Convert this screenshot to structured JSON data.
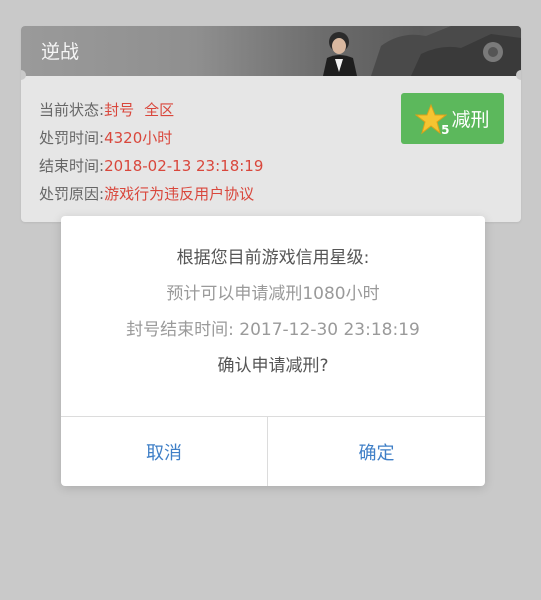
{
  "card": {
    "title": "逆战",
    "status_label": "当前状态:",
    "status_value_1": "封号",
    "status_value_2": "全区",
    "time_label": "处罚时间:",
    "time_value": "4320小时",
    "end_label": "结束时间:",
    "end_value": "2018-02-13 23:18:19",
    "reason_label": "处罚原因:",
    "reason_value": "游戏行为违反用户协议",
    "reduce_button": {
      "label": "减刑",
      "star_count": "5",
      "icon": "star-icon"
    }
  },
  "dialog": {
    "line1": "根据您目前游戏信用星级:",
    "line2": "预计可以申请减刑1080小时",
    "line3": "封号结束时间: 2017-12-30 23:18:19",
    "line4": "确认申请减刑?",
    "cancel_label": "取消",
    "confirm_label": "确定"
  },
  "colors": {
    "accent_red": "#d9473c",
    "button_green": "#5cb85c",
    "dialog_button_blue": "#3f7fc7"
  }
}
